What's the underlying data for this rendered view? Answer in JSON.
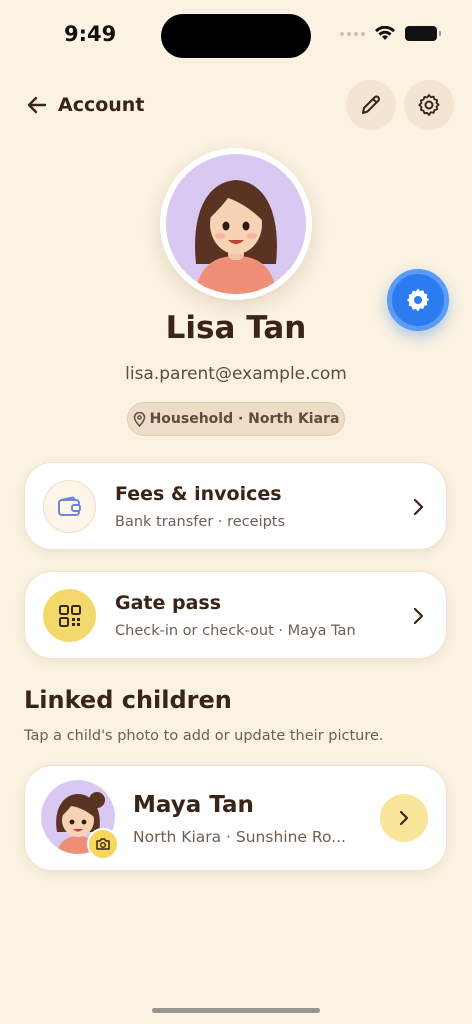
{
  "status_bar": {
    "time": "9:49"
  },
  "header": {
    "back_label": "Account",
    "back_icon": "arrow-left-icon",
    "edit_icon": "pencil-icon",
    "settings_icon": "gear-icon"
  },
  "profile": {
    "name": "Lisa Tan",
    "email": "lisa.parent@example.com",
    "location_label": "Household · North Kiara"
  },
  "actions": [
    {
      "title": "Fees & invoices",
      "subtitle": "Bank transfer · receipts",
      "icon": "wallet-icon"
    },
    {
      "title": "Gate pass",
      "subtitle": "Check-in or check-out · Maya Tan",
      "icon": "qr-code-icon"
    }
  ],
  "linked_children": {
    "title": "Linked children",
    "subtitle": "Tap a child's photo to add or update their picture.",
    "items": [
      {
        "name": "Maya Tan",
        "detail": "North Kiara · Sunshine Ro..."
      }
    ]
  },
  "colors": {
    "background": "#fbf2e1",
    "accent": "#2b7cf1",
    "text": "#3a2418",
    "yellow": "#f5d75b"
  }
}
